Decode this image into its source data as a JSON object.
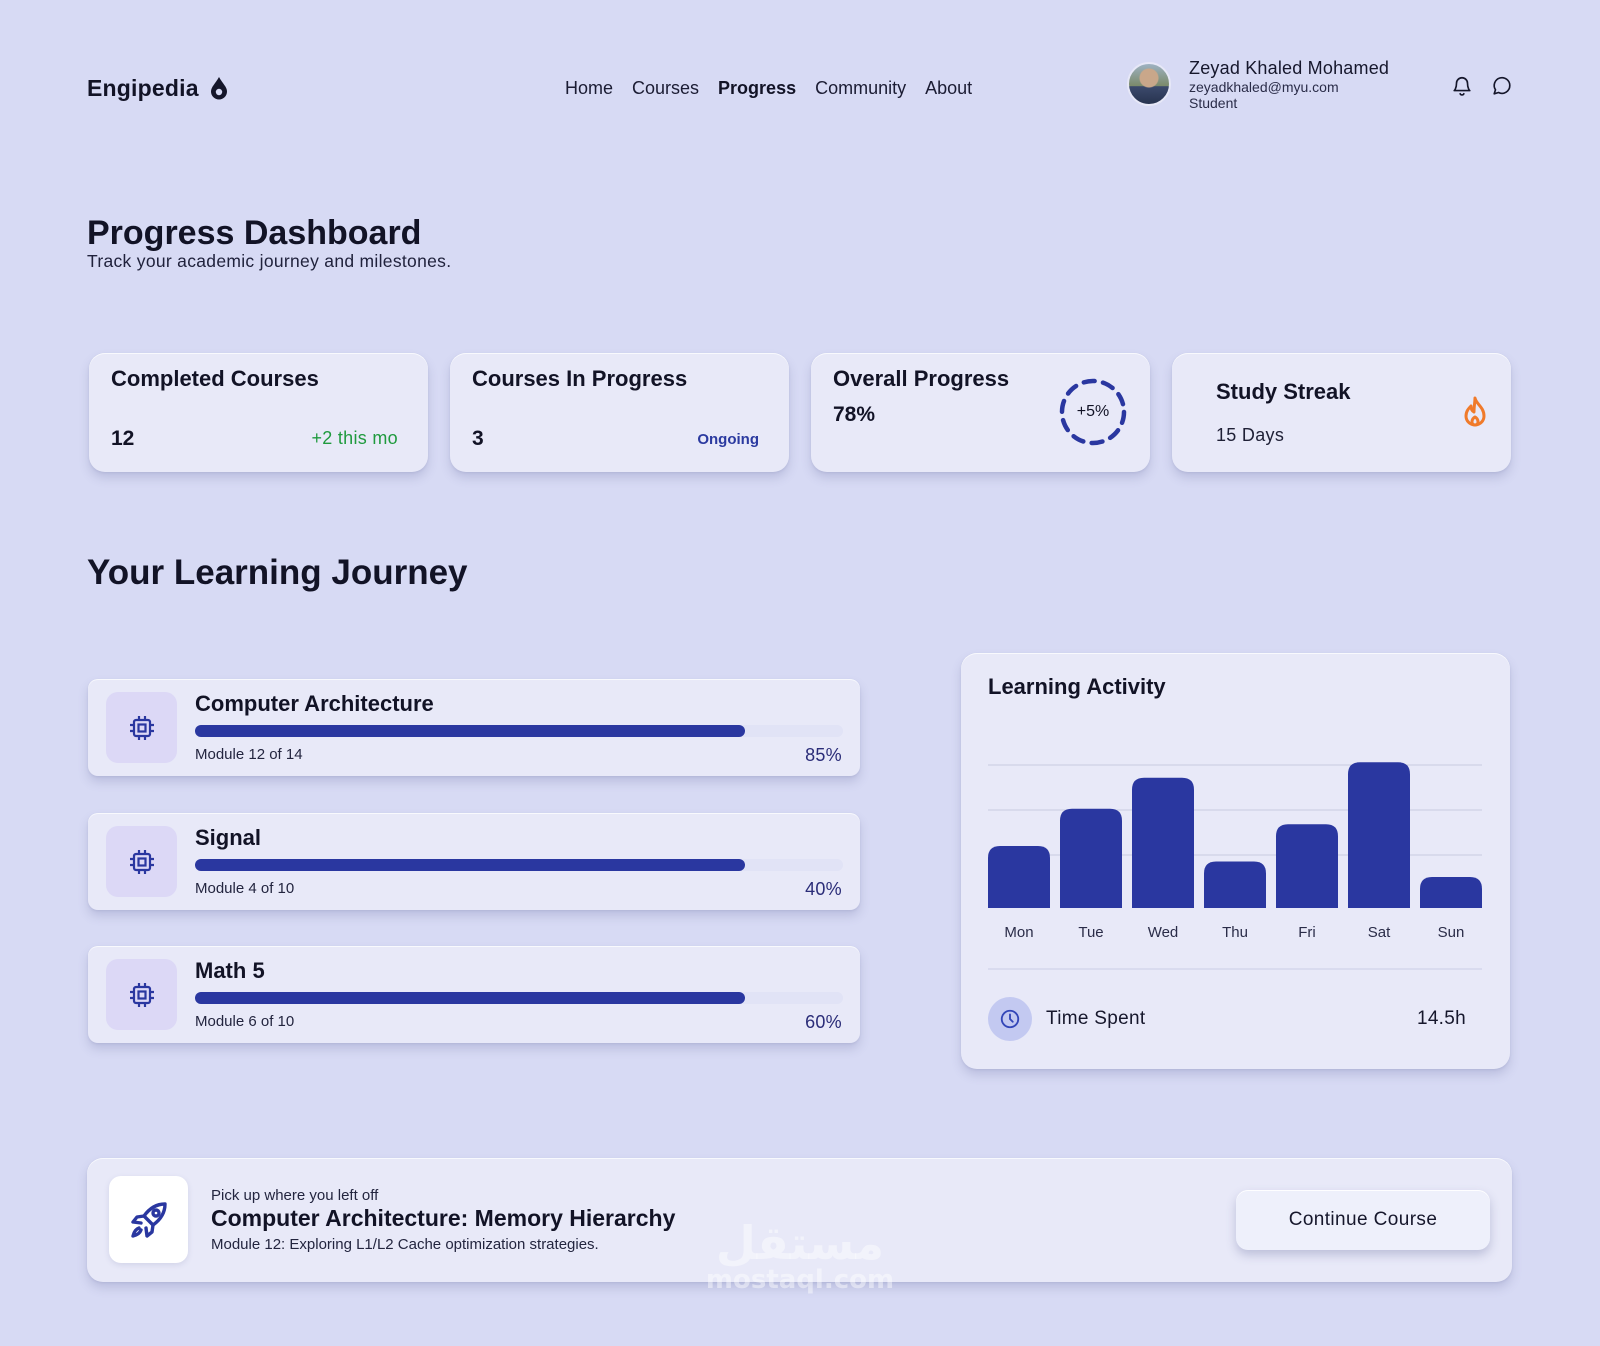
{
  "brand": {
    "name": "Engipedia"
  },
  "nav": {
    "items": [
      {
        "label": "Home",
        "active": false
      },
      {
        "label": "Courses",
        "active": false
      },
      {
        "label": "Progress",
        "active": true
      },
      {
        "label": "Community",
        "active": false
      },
      {
        "label": "About",
        "active": false
      }
    ]
  },
  "user": {
    "name": "Zeyad Khaled Mohamed",
    "email": "zeyadkhaled@myu.com",
    "role": "Student"
  },
  "header_icons": [
    "bell-icon",
    "chat-icon"
  ],
  "page": {
    "title": "Progress Dashboard",
    "subtitle": "Track your academic journey and milestones."
  },
  "stats": {
    "completed": {
      "title": "Completed Courses",
      "value": "12",
      "note": "+2 this mo"
    },
    "in_progress": {
      "title": "Courses In Progress",
      "value": "3",
      "note": "Ongoing"
    },
    "overall": {
      "title": "Overall Progress",
      "value": "78%",
      "badge": "+5%"
    },
    "streak": {
      "title": "Study Streak",
      "value": "15 Days",
      "icon": "flame-icon"
    }
  },
  "journey": {
    "title": "Your Learning Journey",
    "courses": [
      {
        "name": "Computer Architecture",
        "module": "Module 12 of 14",
        "percent_label": "85%",
        "icon": "chip-icon"
      },
      {
        "name": "Signal",
        "module": "Module 4 of 10",
        "percent_label": "40%",
        "icon": "chip-icon"
      },
      {
        "name": "Math 5",
        "module": "Module 6 of 10",
        "percent_label": "60%",
        "icon": "chip-icon"
      }
    ]
  },
  "activity": {
    "title": "Learning Activity",
    "time_label": "Time Spent",
    "time_value": "14.5h",
    "time_icon": "clock-icon"
  },
  "chart_data": {
    "type": "bar",
    "title": "Learning Activity",
    "categories": [
      "Mon",
      "Tue",
      "Wed",
      "Thu",
      "Fri",
      "Sat",
      "Sun"
    ],
    "values": [
      2.0,
      3.2,
      4.2,
      1.5,
      2.7,
      4.7,
      1.0
    ],
    "ylim": [
      0,
      5
    ],
    "grid": true,
    "bar_color": "#2a37a0",
    "xlabel": "",
    "ylabel": ""
  },
  "continue": {
    "kicker": "Pick up where you left off",
    "title": "Computer Architecture: Memory Hierarchy",
    "description": "Module 12: Exploring L1/L2 Cache optimization strategies.",
    "button_label": "Continue Course",
    "icon": "rocket-icon"
  },
  "watermark": {
    "arabic": "مستقل",
    "latin": "mostaql.com"
  },
  "colors": {
    "background": "#d7daf4",
    "card": "#e8e9f8",
    "accent": "#2a37a0",
    "positive": "#1f9a3e",
    "streak": "#f07a2a"
  }
}
